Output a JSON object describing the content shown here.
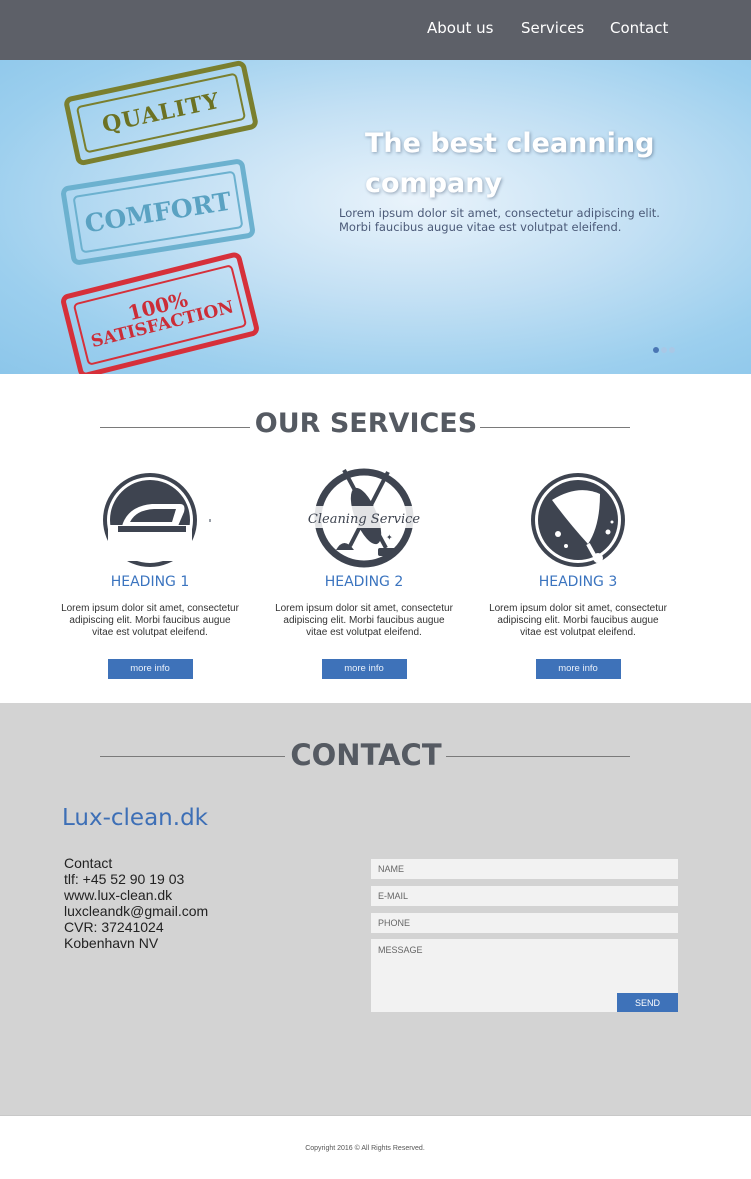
{
  "nav": {
    "items": [
      {
        "label": "About us"
      },
      {
        "label": "Services"
      },
      {
        "label": "Contact"
      }
    ]
  },
  "hero": {
    "stamps": {
      "quality": "QUALITY",
      "comfort": "COMFORT",
      "satisfaction_pct": "100%",
      "satisfaction_word": "SATISFACTION"
    },
    "title": "The best cleanning company",
    "text": "Lorem ipsum dolor sit amet, consectetur adipiscing elit. Morbi faucibus augue vitae est volutpat eleifend.",
    "slides": 3,
    "active_slide": 1
  },
  "services": {
    "title": "OUR SERVICES",
    "items": [
      {
        "heading": "HEADING 1",
        "icon": "iron-icon",
        "text": "Lorem ipsum dolor sit amet, consectetur adipiscing elit. Morbi faucibus augue vitae est volutpat eleifend.",
        "button": "more info"
      },
      {
        "heading": "HEADING 2",
        "icon": "cleaning-service-logo-icon",
        "logo_text": "Cleaning Service",
        "text": "Lorem ipsum dolor sit amet, consectetur adipiscing elit. Morbi faucibus augue vitae est volutpat eleifend.",
        "button": "more info"
      },
      {
        "heading": "HEADING 3",
        "icon": "window-squeegee-icon",
        "text": "Lorem ipsum dolor sit amet, consectetur adipiscing elit. Morbi faucibus augue vitae est volutpat eleifend.",
        "button": "more info"
      }
    ]
  },
  "contact": {
    "title": "CONTACT",
    "brand": "Lux-clean.dk",
    "info": {
      "heading": "Contact",
      "phone": "tlf: +45 52 90 19 03",
      "web": "www.lux-clean.dk",
      "email": "luxcleandk@gmail.com",
      "cvr": "CVR: 37241024",
      "city": "Kobenhavn NV"
    },
    "form": {
      "name_placeholder": "NAME",
      "email_placeholder": "E-MAIL",
      "phone_placeholder": "PHONE",
      "message_placeholder": "MESSAGE",
      "send": "SEND"
    }
  },
  "footer": {
    "copyright": "Copyright 2016 ©  All Rights Reserved."
  },
  "colors": {
    "nav_bg": "#5d6068",
    "accent": "#3e72b9",
    "contact_bg": "#d3d3d3",
    "icon_dark": "#3e4450"
  }
}
